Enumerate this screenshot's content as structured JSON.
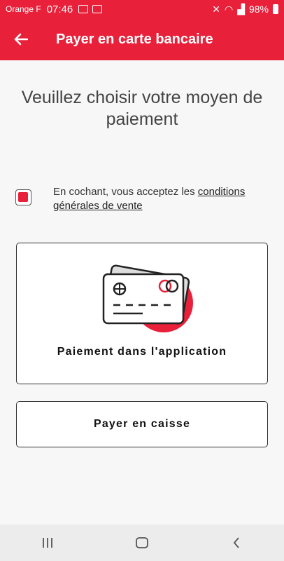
{
  "status_bar": {
    "carrier": "Orange F",
    "time": "07:46",
    "battery": "98%"
  },
  "app_bar": {
    "back_icon": "arrow-left-icon",
    "title": "Payer en carte bancaire"
  },
  "main": {
    "heading": "Veuillez choisir votre moyen de paiement",
    "terms": {
      "prefix": "En cochant, vous acceptez les ",
      "link": "conditions générales de vente",
      "checked": true
    },
    "options": {
      "in_app_label": "Paiement dans l'application",
      "cash_label": "Payer en caisse"
    }
  },
  "nav_bar": {
    "recent_icon": "recent-apps-icon",
    "home_icon": "home-icon",
    "back_icon": "back-nav-icon"
  },
  "colors": {
    "brand": "#e8203a"
  }
}
